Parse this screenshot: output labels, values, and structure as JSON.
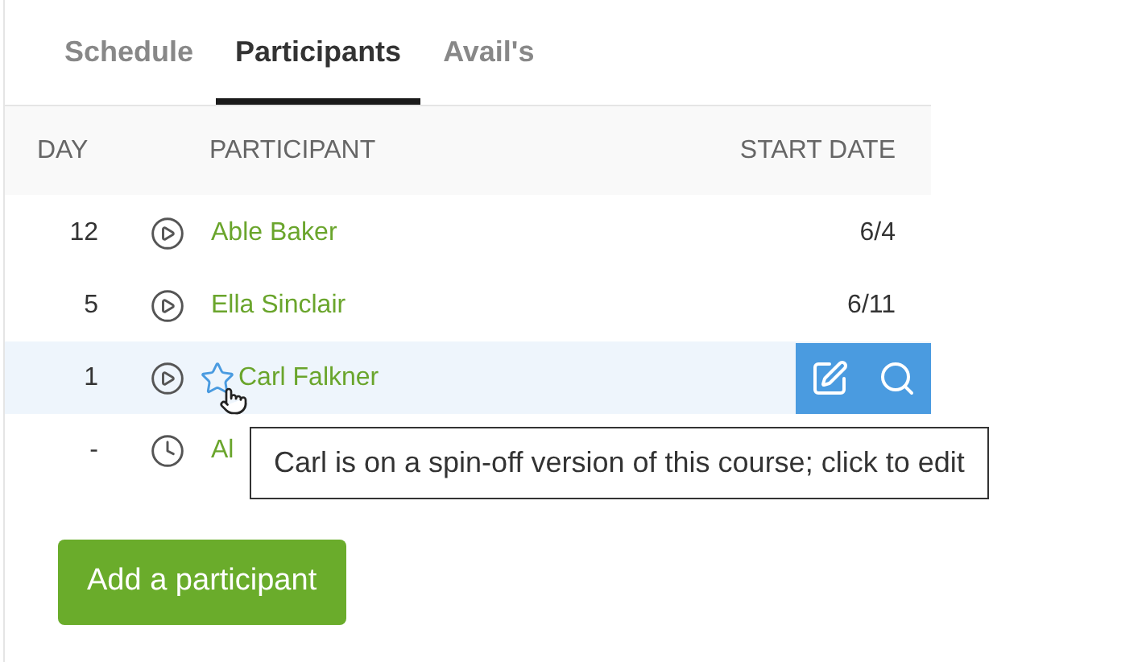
{
  "tabs": [
    {
      "label": "Schedule",
      "selected": false
    },
    {
      "label": "Participants",
      "selected": true
    },
    {
      "label": "Avail's",
      "selected": false
    }
  ],
  "table": {
    "columns": [
      "DAY",
      "PARTICIPANT",
      "START DATE"
    ],
    "rows": [
      {
        "day": "12",
        "scheduled": false,
        "starred": false,
        "name": "Able Baker",
        "start_date": "6/4",
        "hovered": false
      },
      {
        "day": "5",
        "scheduled": false,
        "starred": false,
        "name": "Ella Sinclair",
        "start_date": "6/11",
        "hovered": false
      },
      {
        "day": "1",
        "scheduled": false,
        "starred": true,
        "name": "Carl Falkner",
        "hovered": true
      },
      {
        "day": "-",
        "scheduled": true,
        "starred": false,
        "name": "Al",
        "hovered": false
      }
    ]
  },
  "tooltip": "Carl is on a spin-off version of this course; click to edit",
  "add_button": "Add a participant"
}
